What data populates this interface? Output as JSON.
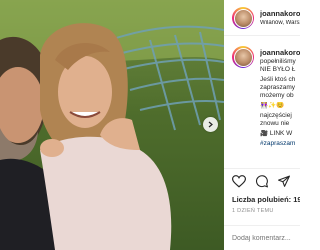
{
  "post": {
    "username": "joannakoroniewska",
    "location": "Wilanów, Warszawa",
    "caption_lines": [
      "popełniliśmy",
      "NIE BYŁO Ł",
      "Jeśli ktoś ch",
      "zapraszamy",
      "możemy ob",
      "👭✨😊",
      "najczęściej",
      "znowu nie ",
      "🎥 LINK W",
      "#zapraszam"
    ],
    "likes_label": "Liczba polubień:",
    "likes_count": "19",
    "time_ago": "1 DZIEŃ TEMU",
    "comment_placeholder": "Dodaj komentarz..."
  },
  "icons": {
    "like": "heart-icon",
    "comment": "comment-icon",
    "share": "share-icon",
    "next": "chevron-right-icon"
  },
  "colors": {
    "text": "#262626",
    "muted": "#8e8e8e",
    "hashtag": "#00376b",
    "divider": "#efefef"
  }
}
